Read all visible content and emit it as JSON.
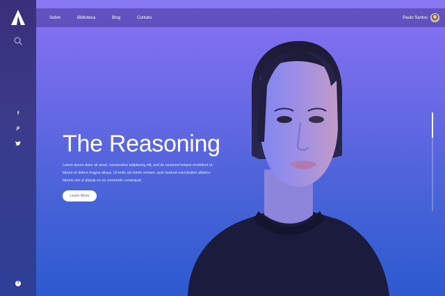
{
  "nav": {
    "items": [
      {
        "label": "Sobre"
      },
      {
        "label": "Biblioteca"
      },
      {
        "label": "Blog"
      },
      {
        "label": "Contato"
      }
    ]
  },
  "user": {
    "name": "Paulo Santos"
  },
  "sidebar": {
    "icons": [
      "logo-a",
      "search-icon",
      "facebook-icon",
      "pinterest-icon",
      "twitter-icon",
      "help-icon"
    ],
    "social": {
      "facebook": "f",
      "pinterest": "p",
      "twitter": "t"
    },
    "help": "?"
  },
  "hero": {
    "title": "The Reasoning",
    "text": "Lorem ipsum dolor sit amet, consectetur adipiscing elit, sed do eiusmod tempor incididunt ut labore et dolore magna aliqua. Ut enim ad minim veniam, quis nostrud exercitation ullamco laboris nisi ut aliquip ex ea commodo consequat.",
    "button": "Learn More"
  },
  "colors": {
    "accent": "#8777f2",
    "sidebar": "#3b3b8a",
    "background_bottom": "#2c5ad0"
  }
}
